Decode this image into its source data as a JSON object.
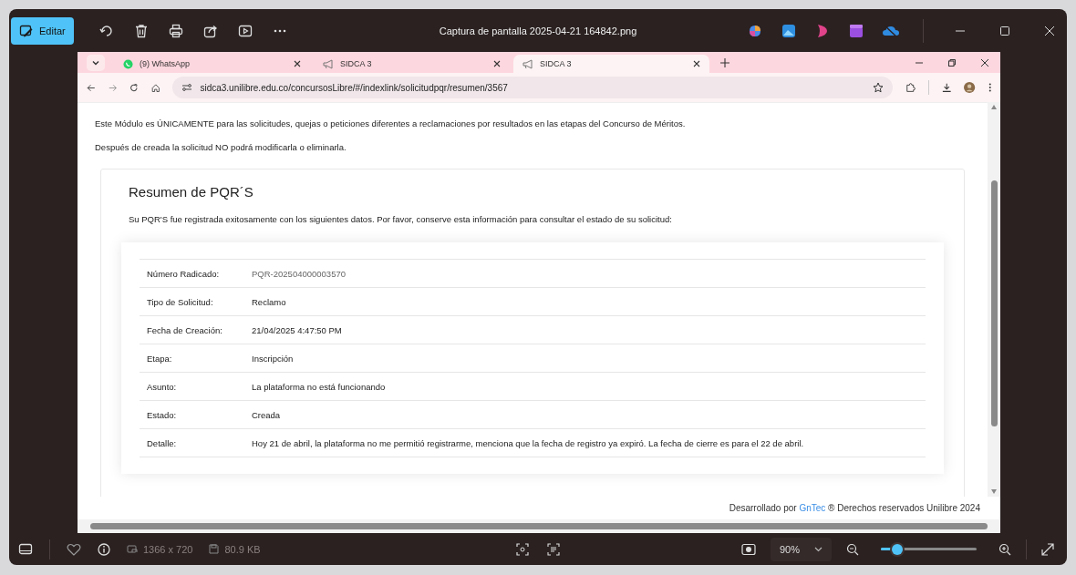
{
  "viewer": {
    "edit_label": "Editar",
    "title": "Captura de pantalla 2025-04-21 164842.png",
    "favorite": false,
    "image_size": "1366 x 720",
    "file_size": "80.9 KB",
    "zoom": {
      "value": "90%",
      "level": 0.17
    }
  },
  "browser": {
    "tabs": [
      {
        "kind": "whatsapp",
        "label": "(9) WhatsApp",
        "selected": false
      },
      {
        "kind": "site",
        "label": "SIDCA 3",
        "selected": false
      },
      {
        "kind": "site",
        "label": "SIDCA 3",
        "selected": true
      }
    ],
    "url": "sidca3.unilibre.edu.co/concursosLibre/#/indexlink/solicitudpqr/resumen/3567"
  },
  "page": {
    "notices": [
      "Este Módulo es ÚNICAMENTE para las solicitudes, quejas o peticiones diferentes a reclamaciones por resultados en las etapas del Concurso de Méritos.",
      "Después de creada la solicitud NO podrá modificarla o eliminarla."
    ],
    "summary": {
      "title": "Resumen de PQR´S",
      "intro": "Su PQR'S fue registrada exitosamente con los siguientes datos. Por favor, conserve esta información para consultar el estado de su solicitud:",
      "rows": [
        {
          "label": "Número Radicado:",
          "value": "PQR-202504000003570"
        },
        {
          "label": "Tipo de Solicitud:",
          "value": "Reclamo"
        },
        {
          "label": "Fecha de Creación:",
          "value": "21/04/2025 4:47:50 PM"
        },
        {
          "label": "Etapa:",
          "value": "Inscripción"
        },
        {
          "label": "Asunto:",
          "value": "La plataforma no está funcionando"
        },
        {
          "label": "Estado:",
          "value": "Creada"
        },
        {
          "label": "Detalle:",
          "value": "Hoy 21 de abril, la plataforma no me permitió registrarme, menciona que la fecha de registro ya expiró. La fecha de cierre es para el 22 de abril."
        }
      ]
    },
    "footer": {
      "before": "Desarrollado por",
      "link": "GnTec",
      "after": "® Derechos reservados Unilibre 2024"
    }
  }
}
